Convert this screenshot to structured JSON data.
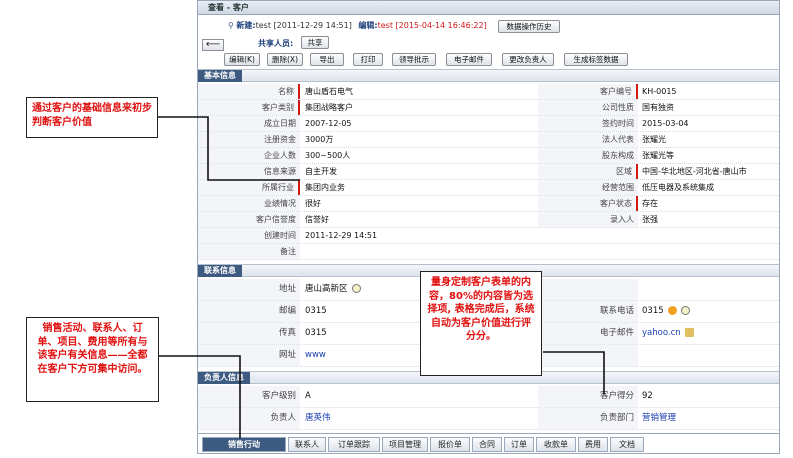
{
  "window": {
    "title": "查看 - 客户"
  },
  "meta": {
    "created_label": "新建:",
    "created_value": "test [2011-12-29 14:51]",
    "edited_label": "编辑:",
    "edited_value": "test [2015-04-14 16:46:22]",
    "history_button": "数据操作历史"
  },
  "sharer": {
    "label": "共享人员:",
    "button": "共享"
  },
  "toolbar": {
    "back": "⟵",
    "buttons": [
      "编辑(K)",
      "删除(X)",
      "导出",
      "打印",
      "领导批示",
      "电子邮件",
      "更改负责人",
      "生成标签数据"
    ]
  },
  "sections": {
    "basic": "基本信息",
    "contact": "联系信息",
    "owner": "负责人信息"
  },
  "basic_rows": [
    {
      "l": "名称",
      "lv": "唐山盾石电气",
      "r": "客户编号",
      "rv": "KH-0015"
    },
    {
      "l": "客户类别",
      "lv": "集团战略客户",
      "r": "公司性质",
      "rv": "国有独资"
    },
    {
      "l": "成立日期",
      "lv": "2007-12-05",
      "r": "签约时间",
      "rv": "2015-03-04"
    },
    {
      "l": "注册资金",
      "lv": "3000万",
      "r": "法人代表",
      "rv": "张耀光"
    },
    {
      "l": "企业人数",
      "lv": "300~500人",
      "r": "股东构成",
      "rv": "张耀光等"
    },
    {
      "l": "信息来源",
      "lv": "自主开发",
      "r": "区域",
      "rv": "中国-华北地区-河北省-唐山市"
    },
    {
      "l": "所属行业",
      "lv": "集团内业务",
      "r": "经营范围",
      "rv": "低压电器及系统集成"
    },
    {
      "l": "业绩情况",
      "lv": "很好",
      "r": "客户状态",
      "rv": "存在"
    },
    {
      "l": "客户信誉度",
      "lv": "信誉好",
      "r": "录入人",
      "rv": "张强"
    },
    {
      "l": "创建时间",
      "lv": "2011-12-29 14:51",
      "r": "",
      "rv": ""
    },
    {
      "l": "备注",
      "lv": "",
      "r": "",
      "rv": ""
    }
  ],
  "contact_rows": [
    {
      "l": "地址",
      "lv": "唐山高新区",
      "r": "",
      "rv": ""
    },
    {
      "l": "邮编",
      "lv": "0315",
      "r": "联系电话",
      "rv": "0315"
    },
    {
      "l": "传真",
      "lv": "0315",
      "r": "电子邮件",
      "rv": "yahoo.cn"
    },
    {
      "l": "网址",
      "lv": "www",
      "r": "",
      "rv": ""
    }
  ],
  "owner_rows": [
    {
      "l": "客户级别",
      "lv": "A",
      "r": "客户得分",
      "rv": "92"
    },
    {
      "l": "负责人",
      "lv": "唐英伟",
      "r": "负责部门",
      "rv": "营销管理"
    }
  ],
  "tabs": [
    "销售行动",
    "联系人",
    "订单跟踪",
    "项目管理",
    "报价单",
    "合同",
    "订单",
    "收款单",
    "费用",
    "文档"
  ],
  "callouts": {
    "basic": "通过客户的基础信息来初步判断客户价值",
    "custom": "量身定制客户表单的内容，80%的内容皆为选择项, 表格完成后，系统自动为客户价值进行评分分。",
    "sales": "销售活动、联系人、订单、项目、费用等所有与该客户有关信息——全都在客户下方可集中访问。"
  },
  "colors": {
    "accent": "#3d5a80",
    "callout_text": "#e01010",
    "required_bar": "#d01818"
  }
}
